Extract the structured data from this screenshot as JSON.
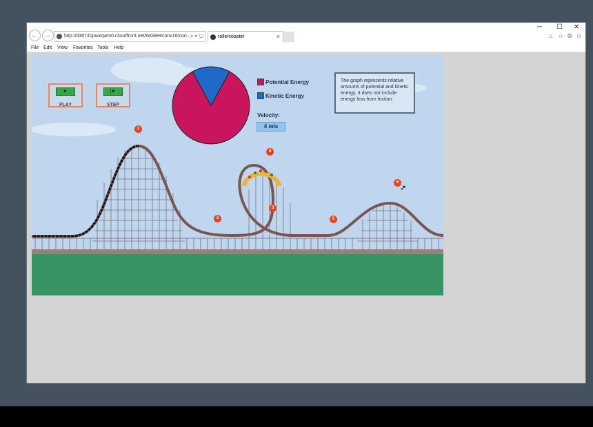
{
  "browser": {
    "url": "http://d3tt741pwxqwm0.cloudfront.net/WGBH/conv16/con..",
    "tab_title": "rollercoaster",
    "tab_close": "×",
    "minimize": "─",
    "maximize": "☐",
    "close": "✕",
    "menu": [
      "File",
      "Edit",
      "View",
      "Favorites",
      "Tools",
      "Help"
    ],
    "address_tools": "⌕ ▾ ↻",
    "back_icon": "arrow-left-icon",
    "forward_icon": "arrow-right-icon"
  },
  "sim": {
    "play_label": "PLAY",
    "step_label": "STEP",
    "play_glyph": "►",
    "step_glyph": "|►",
    "legend": [
      {
        "label": "Potential Energy",
        "color": "#c8155e"
      },
      {
        "label": "Kinetic Energy",
        "color": "#1f6ac8"
      }
    ],
    "velocity_label": "Velocity:",
    "velocity_value": "4 m/s",
    "info_text": "The graph represents relative amounts of potential and kinetic energy. It does not include energy loss from friction.",
    "markers": [
      "1",
      "2",
      "3",
      "4",
      "5",
      "6"
    ]
  },
  "chart_data": {
    "type": "pie",
    "categories": [
      "Potential Energy",
      "Kinetic Energy"
    ],
    "values": [
      84,
      16
    ],
    "colors": [
      "#c8155e",
      "#1f6ac8"
    ]
  }
}
